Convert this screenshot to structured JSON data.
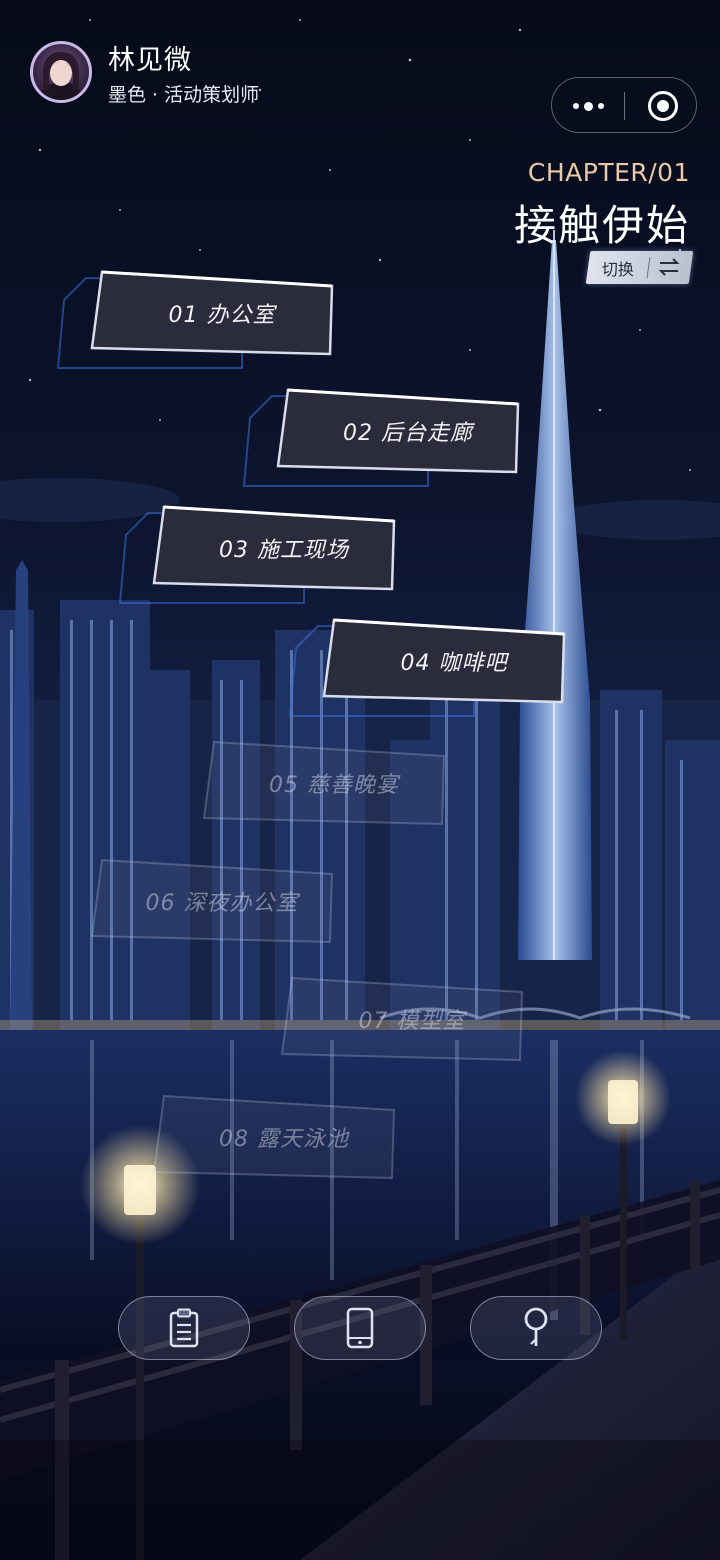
{
  "header": {
    "user_name": "林见微",
    "user_subtitle": "墨色 · 活动策划师"
  },
  "chapter": {
    "label": "CHAPTER/01",
    "title": "接触伊始",
    "switch_label": "切换"
  },
  "scenes": [
    {
      "label": "01  办公室",
      "state": "active"
    },
    {
      "label": "02  后台走廊",
      "state": "active"
    },
    {
      "label": "03  施工现场",
      "state": "active"
    },
    {
      "label": "04  咖啡吧",
      "state": "active"
    },
    {
      "label": "05  慈善晚宴",
      "state": "locked"
    },
    {
      "label": "06  深夜办公室",
      "state": "locked"
    },
    {
      "label": "07  模型室",
      "state": "locked"
    },
    {
      "label": "08  露天泳池",
      "state": "locked"
    }
  ],
  "bottom_nav": [
    {
      "icon": "clipboard-icon"
    },
    {
      "icon": "phone-icon"
    },
    {
      "icon": "search-pin-icon"
    }
  ],
  "colors": {
    "chapter_label": "#e9c9a8",
    "card_glow": "#3b6fd8",
    "sky_top": "#070b1c"
  }
}
